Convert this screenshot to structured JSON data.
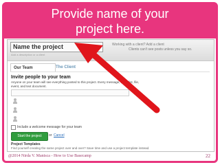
{
  "slide": {
    "title_line1": "Provide name of your",
    "title_line2": "project here.",
    "footer": "@2014  Nirda V. Manisca - How to Use Basecamp",
    "page_number": "22",
    "accent_color": "#e8357e"
  },
  "form": {
    "project_name": "Name the project",
    "description_hint": "Add a description or a client",
    "client_note_line1": "Working with a client? Add a client",
    "client_note_line2": "Clients can't see posts unless you say so.",
    "tabs": [
      {
        "label": "Our Team"
      },
      {
        "label": "The Client"
      }
    ],
    "invite_heading": "Invite people to your team",
    "invite_desc_line1": "Anyone on your team will see everything posted to this project. Every message, to-do list, file,",
    "invite_desc_line2": "event, and text document.",
    "checkbox_label": "Include a welcome message for your team",
    "start_button": "Start the project",
    "or_text": "or",
    "cancel_link": "Cancel",
    "templates_heading": "Project Templates",
    "templates_desc": "Find yourself creating the same project over and over? Save time and use a project template instead."
  },
  "icons": {
    "arrow": "red-pointer-arrow-icon",
    "person": "person-placeholder-icon"
  }
}
